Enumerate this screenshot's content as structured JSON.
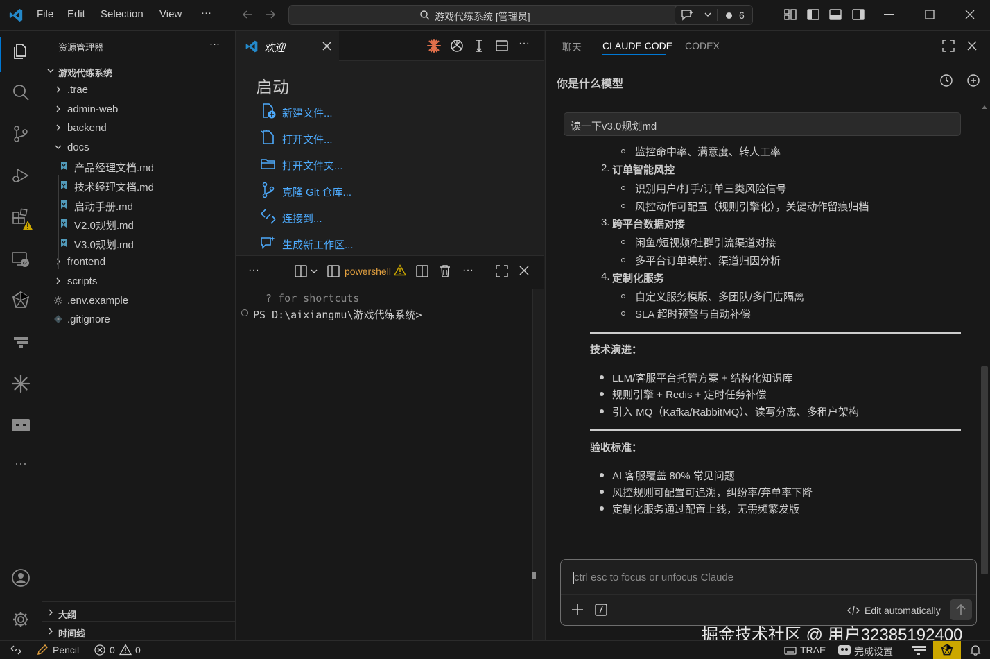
{
  "titlebar": {
    "menu": [
      "File",
      "Edit",
      "Selection",
      "View",
      "···"
    ],
    "command_center": "游戏代练系统 [管理员]",
    "agent_count": "6"
  },
  "sidebar": {
    "title": "资源管理器",
    "more": "···",
    "root": "游戏代练系统",
    "items": [
      {
        "label": ".trae",
        "type": "folder"
      },
      {
        "label": "admin-web",
        "type": "folder"
      },
      {
        "label": "backend",
        "type": "folder"
      },
      {
        "label": "docs",
        "type": "folder-open"
      },
      {
        "label": "产品经理文档.md",
        "type": "md"
      },
      {
        "label": "技术经理文档.md",
        "type": "md"
      },
      {
        "label": "启动手册.md",
        "type": "md"
      },
      {
        "label": "V2.0规划.md",
        "type": "md"
      },
      {
        "label": "V3.0规划.md",
        "type": "md"
      },
      {
        "label": "frontend",
        "type": "folder"
      },
      {
        "label": "scripts",
        "type": "folder"
      },
      {
        "label": ".env.example",
        "type": "gear"
      },
      {
        "label": ".gitignore",
        "type": "git"
      }
    ],
    "outline": "大纲",
    "timeline": "时间线"
  },
  "editor": {
    "tab_label": "欢迎",
    "start_heading": "启动",
    "start_items": [
      "新建文件...",
      "打开文件...",
      "打开文件夹...",
      "克隆 Git 仓库...",
      "连接到...",
      "生成新工作区..."
    ]
  },
  "terminal": {
    "more": "···",
    "shell_name": "powershell",
    "shortcut_hint": "? for shortcuts",
    "prompt": "PS D:\\aixiangmu\\游戏代练系统>"
  },
  "rightpanel": {
    "tabs": [
      "聊天",
      "CLAUDE CODE",
      "CODEX"
    ],
    "active_tab": "CLAUDE CODE",
    "conversation_title": "你是什么模型",
    "user_message": "读一下v3.0规划md",
    "content": {
      "line_top": "监控命中率、满意度、转人工率",
      "sec2_title": "订单智能风控",
      "sec2_items": [
        "识别用户/打手/订单三类风险信号",
        "风控动作可配置（规则引擎化），关键动作留痕归档"
      ],
      "sec3_title": "跨平台数据对接",
      "sec3_items": [
        "闲鱼/短视频/社群引流渠道对接",
        "多平台订单映射、渠道归因分析"
      ],
      "sec4_title": "定制化服务",
      "sec4_items": [
        "自定义服务模版、多团队/多门店隔离",
        "SLA 超时预警与自动补偿"
      ],
      "num2": "2.",
      "num3": "3.",
      "num4": "4.",
      "tech_title": "技术演进：",
      "tech_items": [
        "LLM/客服平台托管方案 + 结构化知识库",
        "规则引擎 + Redis + 定时任务补偿",
        "引入 MQ（Kafka/RabbitMQ）、读写分离、多租户架构"
      ],
      "accept_title": "验收标准：",
      "accept_items": [
        "AI 客服覆盖 80% 常见问题",
        "风控规则可配置可追溯，纠纷率/弃单率下降",
        "定制化服务通过配置上线，无需频繁发版"
      ]
    },
    "input_placeholder": "ctrl esc to focus or unfocus Claude",
    "edit_mode": "Edit automatically"
  },
  "statusbar": {
    "pencil": "Pencil",
    "errors": "0",
    "warnings": "0",
    "trae": "TRAE",
    "setup": "完成设置"
  },
  "watermark": "掘金技术社区 @ 用户32385192400",
  "colors": {
    "accent": "#0078d4",
    "link": "#4daafc",
    "warning": "#cca700",
    "md_icon": "#519aba",
    "bg": "#1f1f1f",
    "panel": "#181818"
  }
}
